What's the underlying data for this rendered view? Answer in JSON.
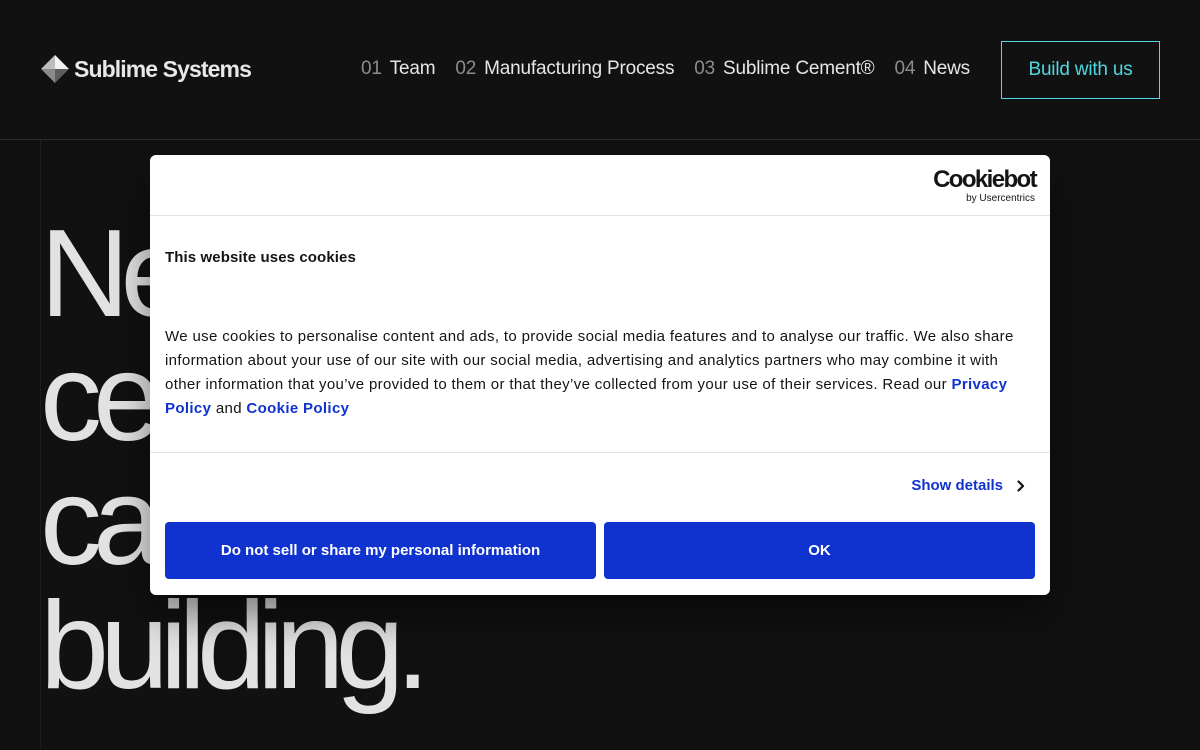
{
  "header": {
    "brand": "Sublime Systems",
    "logo_icon": "diamond-logo-icon",
    "nav": [
      {
        "num": "01",
        "label": "Team"
      },
      {
        "num": "02",
        "label": "Manufacturing Process"
      },
      {
        "num": "03",
        "label": "Sublime Cement®"
      },
      {
        "num": "04",
        "label": "News"
      }
    ],
    "cta_label": "Build with us"
  },
  "hero": {
    "lines": [
      "Ne",
      "ce",
      "ca",
      "building."
    ]
  },
  "cookie": {
    "brand": "Cookiebot",
    "brand_sub": "by Usercentrics",
    "title": "This website uses cookies",
    "body": "We use cookies to personalise content and ads, to provide social media features and to analyse our traffic. We also share information about your use of our site with our social media, advertising and analytics partners who may combine it with other information that you’ve provided to them or that they’ve collected from your use of their services. Read our ",
    "privacy_link": "Privacy Policy",
    "and_text": " and ",
    "cookie_link": "Cookie Policy",
    "show_details": "Show details",
    "deny_label": "Do not sell or share my personal information",
    "ok_label": "OK"
  },
  "colors": {
    "background": "#111111",
    "accent_cyan": "#4fd7e4",
    "cookie_blue": "#1032cf"
  }
}
